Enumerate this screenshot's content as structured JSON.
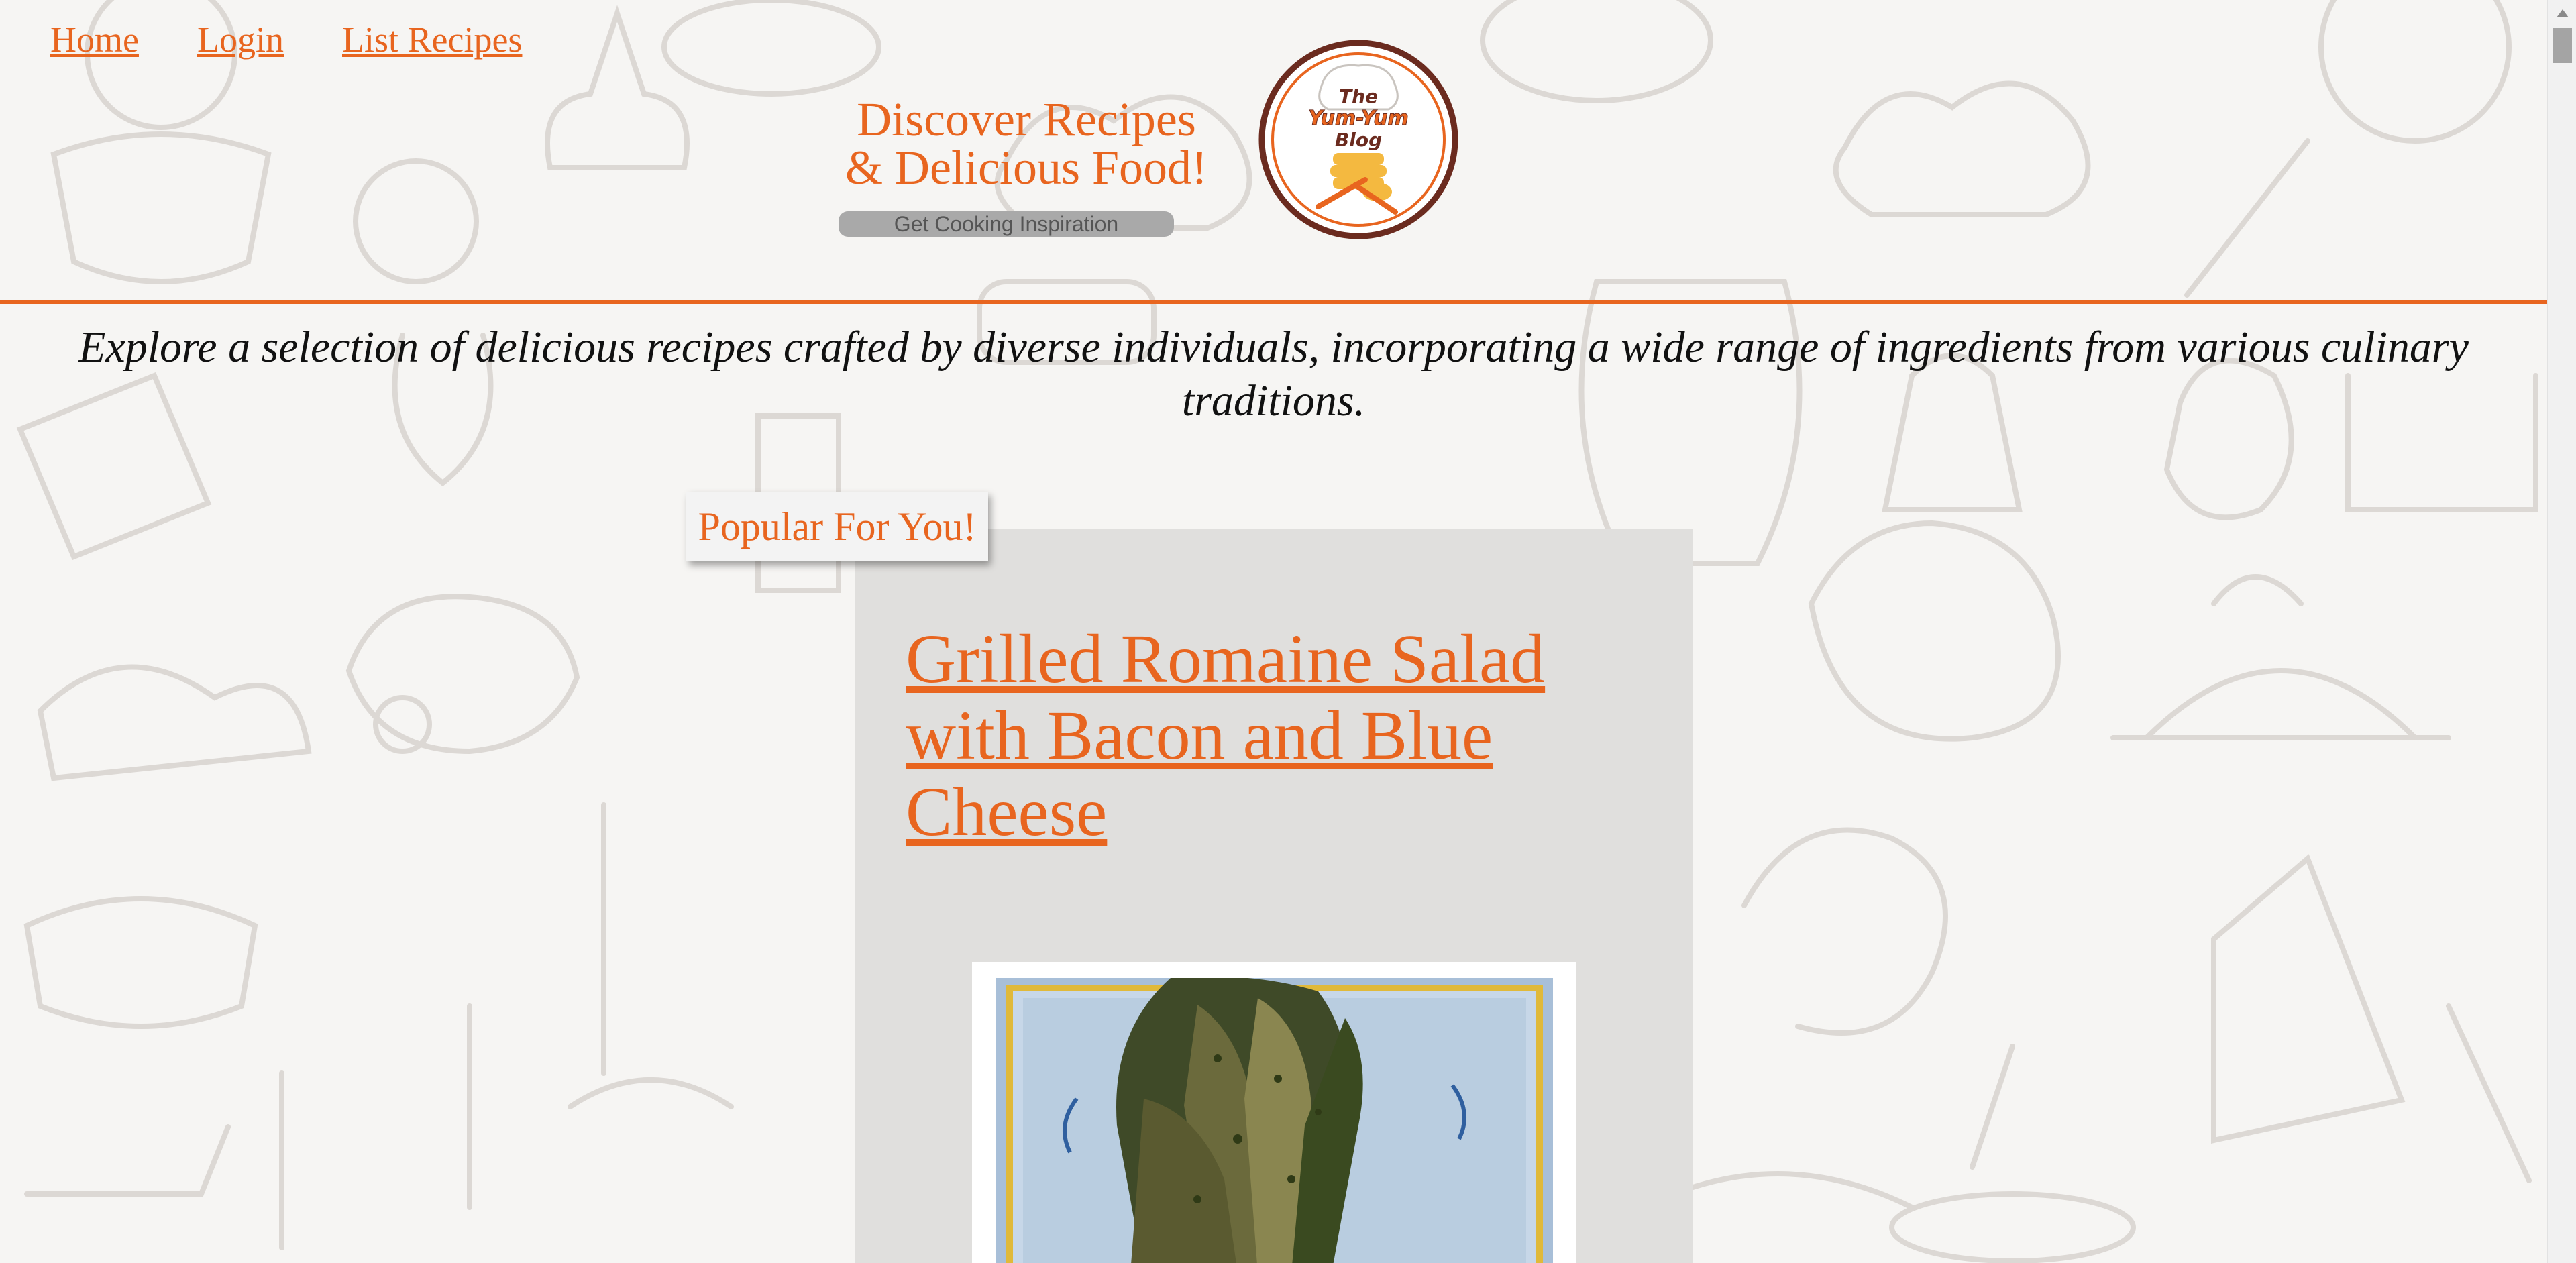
{
  "nav": {
    "items": [
      {
        "label": "Home"
      },
      {
        "label": "Login"
      },
      {
        "label": "List Recipes"
      }
    ]
  },
  "hero": {
    "title_line1": "Discover Recipes",
    "title_line2": "& Delicious Food!",
    "button_label": "Get Cooking Inspiration"
  },
  "logo": {
    "line1": "The",
    "line2": "Yum-Yum",
    "line3": "Blog"
  },
  "intro_text": "Explore a selection of delicious recipes crafted by diverse individuals, incorporating a wide range of ingredients from various culinary traditions.",
  "popular": {
    "tag_label": "Popular For You!",
    "recipe_title": "Grilled Romaine Salad with Bacon and Blue Cheese"
  },
  "colors": {
    "accent": "#e8651f",
    "logo_ring": "#6b2b1f",
    "card_bg": "#e0dfdd",
    "page_bg": "#f6f5f3"
  }
}
